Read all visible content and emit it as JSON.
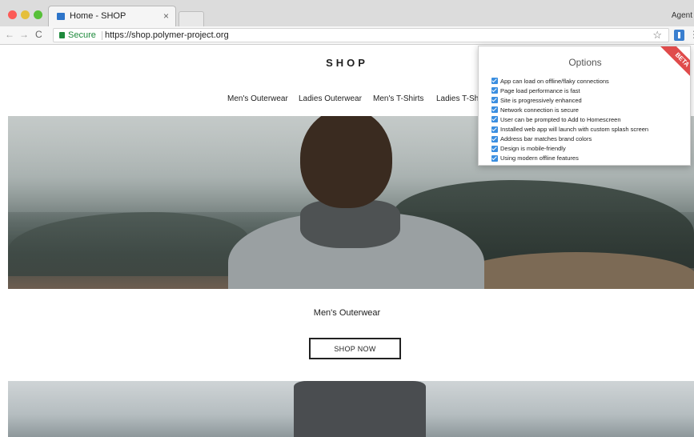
{
  "browser": {
    "tab_title": "Home - SHOP",
    "tab_close": "×",
    "user_label": "Agent",
    "secure_label": "Secure",
    "url": "https://shop.polymer-project.org",
    "back": "←",
    "forward": "→",
    "reload": "C",
    "star": "☆",
    "menu": "⋮"
  },
  "page": {
    "title": "SHOP",
    "categories": [
      "Men's Outerwear",
      "Ladies Outerwear",
      "Men's T-Shirts",
      "Ladies T-Shirts"
    ],
    "section_title": "Men's Outerwear",
    "shop_now": "SHOP NOW"
  },
  "popup": {
    "title": "Options",
    "badge": "BETA",
    "options": [
      "App can load on offline/flaky connections",
      "Page load performance is fast",
      "Site is progressively enhanced",
      "Network connection is secure",
      "User can be prompted to Add to Homescreen",
      "Installed web app will launch with custom splash screen",
      "Address bar matches brand colors",
      "Design is mobile-friendly",
      "Using modern offline features"
    ]
  },
  "colors": {
    "secure_green": "#1e8a3c",
    "checkbox_blue": "#3a8ee0",
    "beta_red": "#e04b4b"
  }
}
